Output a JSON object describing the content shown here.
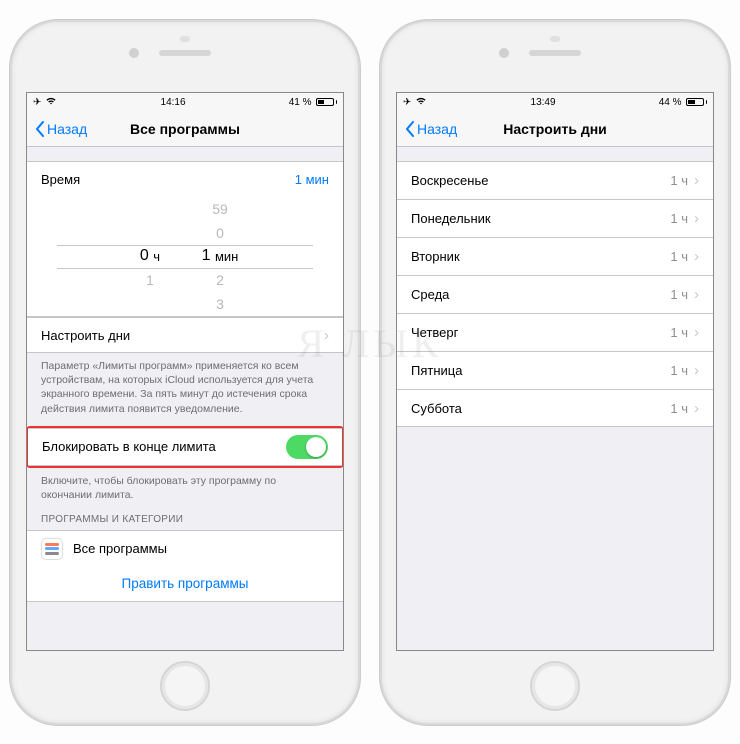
{
  "left": {
    "statusbar": {
      "time": "14:16",
      "battery_pct": "41 %",
      "battery_fill": 41
    },
    "back_label": "Назад",
    "title": "Все программы",
    "time_row": {
      "label": "Время",
      "value": "1 мин"
    },
    "picker": {
      "hours_above": [
        "",
        ""
      ],
      "hours_sel": "0",
      "hours_unit": "ч",
      "hours_below": [
        "1",
        ""
      ],
      "mins_above": [
        "59",
        "0"
      ],
      "mins_sel": "1",
      "mins_unit": "мин",
      "mins_below": [
        "2",
        "3"
      ]
    },
    "customize_days": "Настроить дни",
    "footer1": "Параметр «Лимиты программ» применяется ко всем устройствам, на которых iCloud используется для учета экранного времени. За пять минут до истечения срока действия лимита появится уведомление.",
    "block_row": {
      "label": "Блокировать в конце лимита",
      "on": true
    },
    "footer2": "Включите, чтобы блокировать эту программу по окончании лимита.",
    "section_header": "ПРОГРАММЫ И КАТЕГОРИИ",
    "app_row": "Все программы",
    "edit_link": "Править программы"
  },
  "right": {
    "statusbar": {
      "time": "13:49",
      "battery_pct": "44 %",
      "battery_fill": 44
    },
    "back_label": "Назад",
    "title": "Настроить дни",
    "days": [
      {
        "name": "Воскресенье",
        "value": "1 ч"
      },
      {
        "name": "Понедельник",
        "value": "1 ч"
      },
      {
        "name": "Вторник",
        "value": "1 ч"
      },
      {
        "name": "Среда",
        "value": "1 ч"
      },
      {
        "name": "Четверг",
        "value": "1 ч"
      },
      {
        "name": "Пятница",
        "value": "1 ч"
      },
      {
        "name": "Суббота",
        "value": "1 ч"
      }
    ]
  },
  "watermark": "Я ЛЫК"
}
